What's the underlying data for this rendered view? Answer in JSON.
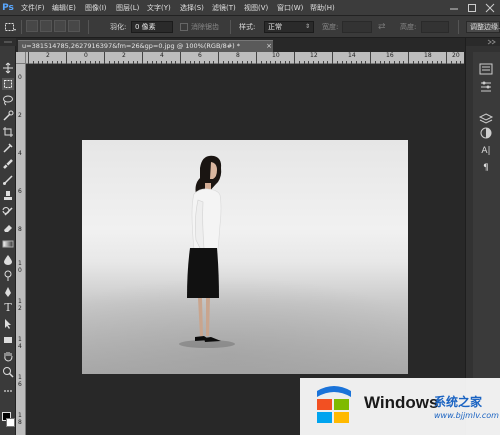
{
  "app": {
    "logo": "Ps"
  },
  "menu": {
    "items": [
      "文件(F)",
      "编辑(E)",
      "图像(I)",
      "图层(L)",
      "文字(Y)",
      "选择(S)",
      "滤镜(T)",
      "视图(V)",
      "窗口(W)",
      "帮助(H)"
    ]
  },
  "options_bar": {
    "feather_label": "羽化:",
    "feather_value": "0 像素",
    "antialias_label": "消除锯齿",
    "style_label": "样式:",
    "style_value": "正常",
    "width_label": "宽度:",
    "height_label": "高度:",
    "refine_edge_label": "调整边缘..."
  },
  "document": {
    "tab_title": "u=381514785,2627916397&fm=26&gp=0.jpg @ 100%(RGB/8#) *",
    "close_glyph": "×"
  },
  "ruler": {
    "top_labels": [
      "2",
      "0",
      "2",
      "4",
      "6",
      "8",
      "10",
      "12",
      "14",
      "16",
      "18",
      "20"
    ],
    "left_labels": [
      "0",
      "2",
      "4",
      "6",
      "8",
      "1",
      "0",
      "1",
      "2",
      "1",
      "4",
      "1",
      "6",
      "1",
      "8"
    ]
  },
  "tools": [
    "move-tool-icon",
    "marquee-tool-icon",
    "lasso-tool-icon",
    "quick-select-tool-icon",
    "crop-tool-icon",
    "eyedropper-tool-icon",
    "healing-brush-tool-icon",
    "brush-tool-icon",
    "clone-stamp-tool-icon",
    "history-brush-tool-icon",
    "eraser-tool-icon",
    "gradient-tool-icon",
    "blur-tool-icon",
    "dodge-tool-icon",
    "pen-tool-icon",
    "type-tool-icon",
    "path-select-tool-icon",
    "rectangle-tool-icon",
    "hand-tool-icon",
    "zoom-tool-icon"
  ],
  "type_tool_glyph": "T",
  "right_panel": {
    "char_glyph": "A|",
    "para_glyph": "¶"
  },
  "watermark": {
    "brand": "Windows",
    "site_cn": "系统之家",
    "url": "www.bjjmlv.com"
  },
  "colors": {
    "ui_dark": "#282828",
    "ui_panel": "#3a3a3a",
    "accent_blue": "#1a63c2"
  }
}
